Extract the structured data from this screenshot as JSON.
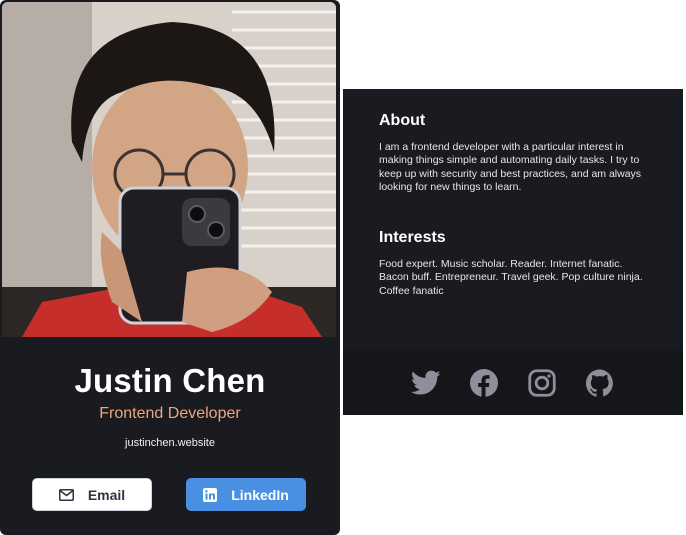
{
  "profile": {
    "name": "Justin Chen",
    "role": "Frontend Developer",
    "website": "justinchen.website",
    "email_label": "Email",
    "linkedin_label": "LinkedIn"
  },
  "about": {
    "title": "About",
    "text": "I am a frontend developer with a particular interest in making things simple and automating daily tasks. I try to keep up with security and best practices, and am always looking for new things to learn."
  },
  "interests": {
    "title": "Interests",
    "text": "Food expert. Music scholar. Reader. Internet fanatic. Bacon buff. Entrepreneur. Travel geek. Pop culture ninja. Coffee fanatic"
  },
  "social_icons": [
    "twitter-icon",
    "facebook-icon",
    "instagram-icon",
    "github-icon"
  ],
  "colors": {
    "card_bg": "#1a1b21",
    "footer_bg": "#151619",
    "accent_role": "#f1a679",
    "linkedin_blue": "#4a90e2",
    "social_icon": "#918e9b"
  }
}
